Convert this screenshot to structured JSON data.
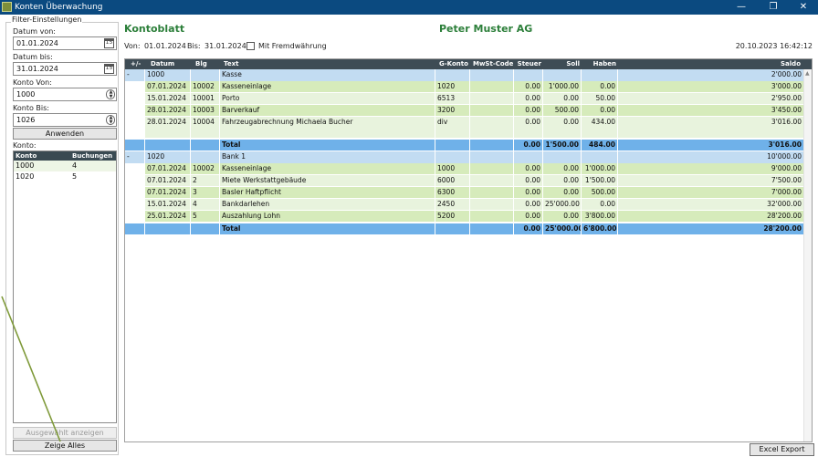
{
  "window": {
    "title": "Konten Überwachung",
    "minimize": "—",
    "restore": "❐",
    "close": "✕"
  },
  "sidebar": {
    "group_title": "Filter-Einstellungen",
    "datum_von_label": "Datum von:",
    "datum_von_value": "01.01.2024",
    "datum_bis_label": "Datum bis:",
    "datum_bis_value": "31.01.2024",
    "calendar_glyph": "15",
    "konto_von_label": "Konto Von:",
    "konto_von_value": "1000",
    "konto_bis_label": "Konto Bis:",
    "konto_bis_value": "1026",
    "apply_label": "Anwenden",
    "konto_label": "Konto:",
    "list_headers": {
      "konto": "Konto",
      "buchungen": "Buchungen"
    },
    "list_rows": [
      {
        "konto": "1000",
        "buchungen": "4"
      },
      {
        "konto": "1020",
        "buchungen": "5"
      }
    ],
    "show_selected_label": "Ausgewählt anzeigen",
    "show_all_label": "Zeige Alles"
  },
  "main": {
    "title": "Kontoblatt",
    "company": "Peter Muster AG",
    "von_label": "Von:",
    "von_value": "01.01.2024",
    "bis_label": "Bis:",
    "bis_value": "31.01.2024",
    "fremd_label": "Mit Fremdwährung",
    "timestamp": "20.10.2023 16:42:12",
    "excel_label": "Excel Export"
  },
  "grid": {
    "headers": {
      "toggle": "+/-",
      "datum": "Datum",
      "blg": "Blg",
      "text": "Text",
      "gkonto": "G-Konto",
      "mwst": "MwSt-Code",
      "steuer": "Steuer",
      "soll": "Soll",
      "haben": "Haben",
      "saldo": "Saldo"
    },
    "groups": [
      {
        "toggle": "-",
        "konto": "1000",
        "name": "Kasse",
        "saldo": "2'000.00",
        "rows": [
          {
            "datum": "07.01.2024",
            "blg": "10002",
            "text": "Kasseneinlage",
            "gkonto": "1020",
            "mwst": "",
            "steuer": "0.00",
            "soll": "1'000.00",
            "haben": "0.00",
            "saldo": "3'000.00"
          },
          {
            "datum": "15.01.2024",
            "blg": "10001",
            "text": "Porto",
            "gkonto": "6513",
            "mwst": "",
            "steuer": "0.00",
            "soll": "0.00",
            "haben": "50.00",
            "saldo": "2'950.00"
          },
          {
            "datum": "28.01.2024",
            "blg": "10003",
            "text": "Barverkauf",
            "gkonto": "3200",
            "mwst": "",
            "steuer": "0.00",
            "soll": "500.00",
            "haben": "0.00",
            "saldo": "3'450.00"
          },
          {
            "datum": "28.01.2024",
            "blg": "10004",
            "text": "Fahrzeugabrechnung Michaela Bucher",
            "gkonto": "div",
            "mwst": "",
            "steuer": "0.00",
            "soll": "0.00",
            "haben": "434.00",
            "saldo": "3'016.00"
          }
        ],
        "total": {
          "label": "Total",
          "steuer": "0.00",
          "soll": "1'500.00",
          "haben": "484.00",
          "saldo": "3'016.00"
        }
      },
      {
        "toggle": "-",
        "konto": "1020",
        "name": "Bank 1",
        "saldo": "10'000.00",
        "rows": [
          {
            "datum": "07.01.2024",
            "blg": "10002",
            "text": "Kasseneinlage",
            "gkonto": "1000",
            "mwst": "",
            "steuer": "0.00",
            "soll": "0.00",
            "haben": "1'000.00",
            "saldo": "9'000.00"
          },
          {
            "datum": "07.01.2024",
            "blg": "2",
            "text": "Miete Werkstattgebäude",
            "gkonto": "6000",
            "mwst": "",
            "steuer": "0.00",
            "soll": "0.00",
            "haben": "1'500.00",
            "saldo": "7'500.00"
          },
          {
            "datum": "07.01.2024",
            "blg": "3",
            "text": "Basler Haftpflicht",
            "gkonto": "6300",
            "mwst": "",
            "steuer": "0.00",
            "soll": "0.00",
            "haben": "500.00",
            "saldo": "7'000.00"
          },
          {
            "datum": "15.01.2024",
            "blg": "4",
            "text": "Bankdarlehen",
            "gkonto": "2450",
            "mwst": "",
            "steuer": "0.00",
            "soll": "25'000.00",
            "haben": "0.00",
            "saldo": "32'000.00"
          },
          {
            "datum": "25.01.2024",
            "blg": "5",
            "text": "Auszahlung Lohn",
            "gkonto": "5200",
            "mwst": "",
            "steuer": "0.00",
            "soll": "0.00",
            "haben": "3'800.00",
            "saldo": "28'200.00"
          }
        ],
        "total": {
          "label": "Total",
          "steuer": "0.00",
          "soll": "25'000.00",
          "haben": "6'800.00",
          "saldo": "28'200.00"
        }
      }
    ]
  },
  "colors": {
    "accent_green": "#2c7f3a",
    "header_dark": "#3e4c55",
    "group_blue": "#c2dcf2",
    "total_blue": "#6fb1e9",
    "row_green": "#e8f3dd",
    "row_green_alt": "#d6ebbb",
    "titlebar": "#0b4a80"
  }
}
